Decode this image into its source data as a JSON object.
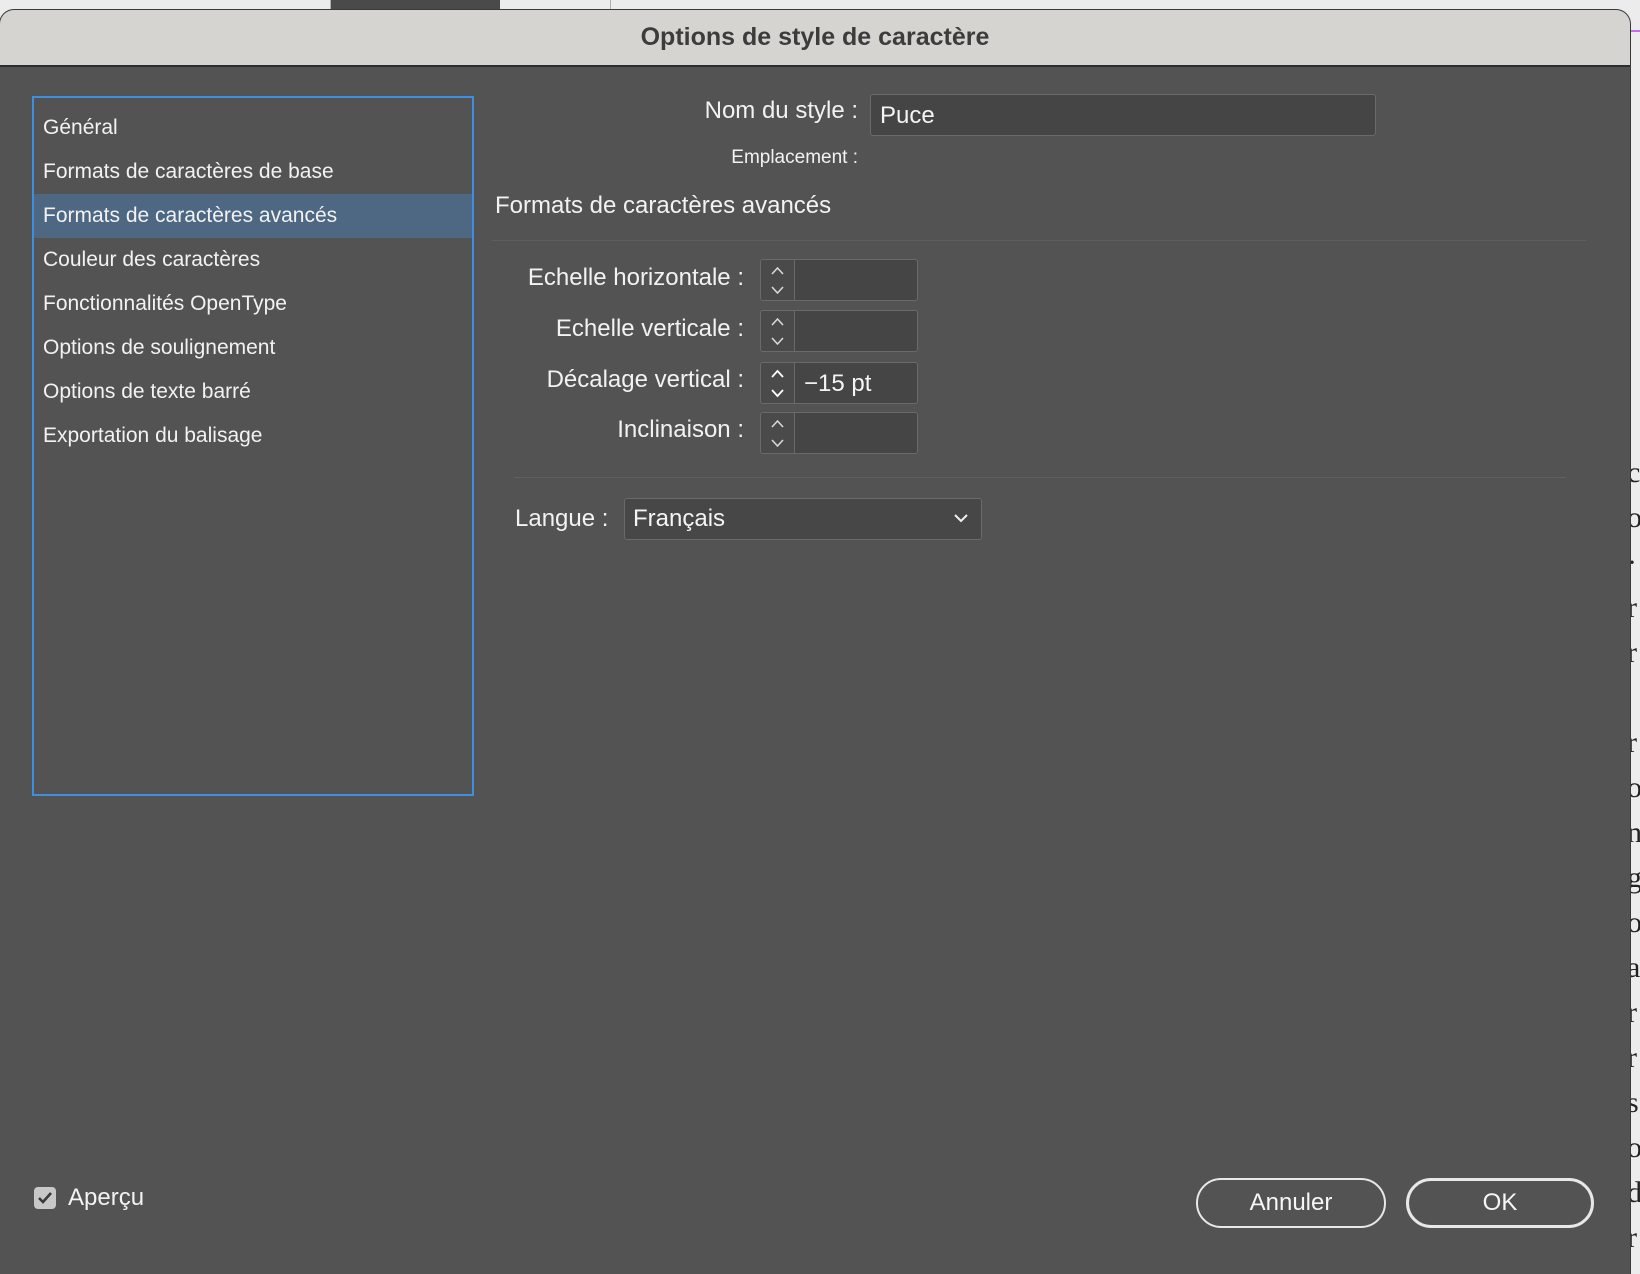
{
  "dialog": {
    "title": "Options de style de caractère"
  },
  "sidebar": {
    "items": [
      {
        "label": "Général",
        "selected": false
      },
      {
        "label": "Formats de caractères de base",
        "selected": false
      },
      {
        "label": "Formats de caractères avancés",
        "selected": true
      },
      {
        "label": "Couleur des caractères",
        "selected": false
      },
      {
        "label": "Fonctionnalités OpenType",
        "selected": false
      },
      {
        "label": "Options de soulignement",
        "selected": false
      },
      {
        "label": "Options de texte barré",
        "selected": false
      },
      {
        "label": "Exportation du balisage",
        "selected": false
      }
    ]
  },
  "style": {
    "name_label": "Nom du style :",
    "name_value": "Puce",
    "location_label": "Emplacement :"
  },
  "section": {
    "title": "Formats de caractères avancés",
    "fields": [
      {
        "label": "Echelle horizontale :",
        "value": ""
      },
      {
        "label": "Echelle verticale :",
        "value": ""
      },
      {
        "label": "Décalage vertical :",
        "value": "−15 pt"
      },
      {
        "label": "Inclinaison :",
        "value": ""
      }
    ],
    "language_label": "Langue :",
    "language_value": "Français"
  },
  "footer": {
    "preview_label": "Aperçu",
    "preview_checked": true,
    "cancel_label": "Annuler",
    "ok_label": "OK"
  },
  "background": {
    "letters": [
      "c",
      "o",
      "·",
      "r",
      "r",
      "",
      "r",
      "o",
      "n",
      "g",
      "o",
      "a",
      "r",
      "r",
      "s",
      "o",
      "d",
      "r"
    ]
  },
  "colors": {
    "dialog_bg": "#535353",
    "titlebar_bg": "#d6d4d1",
    "selection_bg": "#4e6782",
    "focus_border": "#3f8fe0"
  }
}
